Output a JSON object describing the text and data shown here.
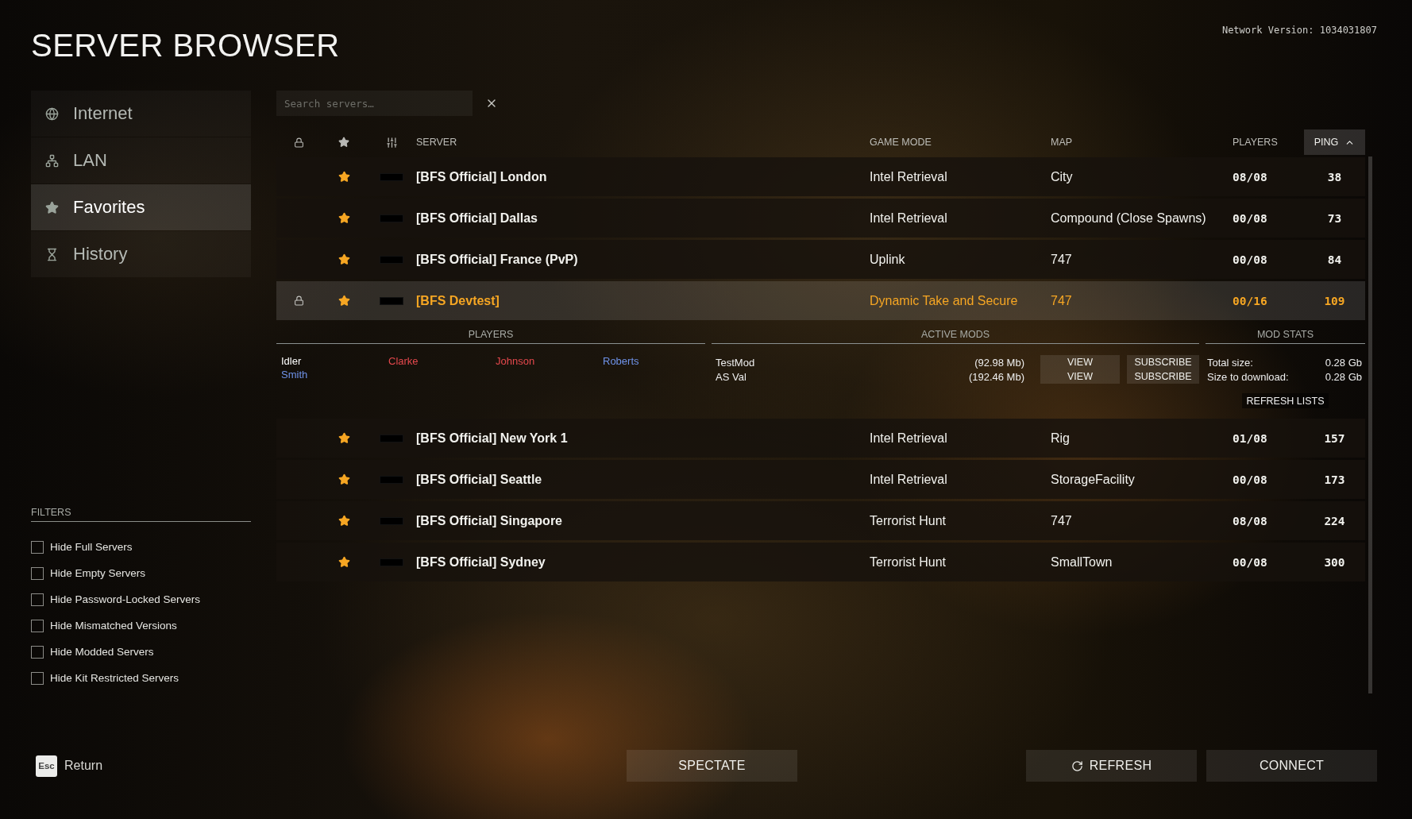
{
  "title": "SERVER BROWSER",
  "network_version": "Network Version: 1034031807",
  "nav": [
    {
      "label": "Internet",
      "kind": "globe",
      "selected": false
    },
    {
      "label": "LAN",
      "kind": "network",
      "selected": false
    },
    {
      "label": "Favorites",
      "kind": "star",
      "selected": true
    },
    {
      "label": "History",
      "kind": "hourglass",
      "selected": false
    }
  ],
  "search": {
    "placeholder": "Search servers…"
  },
  "columns": [
    {
      "label": "SERVER",
      "selected": false
    },
    {
      "label": "GAME MODE",
      "selected": false
    },
    {
      "label": "MAP",
      "selected": false
    },
    {
      "label": "PLAYERS",
      "selected": false
    },
    {
      "label": "PING",
      "selected": true
    }
  ],
  "servers": [
    {
      "name": "[BFS Official] London",
      "game_mode": "Intel Retrieval",
      "map": "City",
      "players": "08/08",
      "ping": "38",
      "locked": false,
      "favorite": true,
      "selected": false
    },
    {
      "name": "[BFS Official] Dallas",
      "game_mode": "Intel Retrieval",
      "map": "Compound (Close Spawns)",
      "players": "00/08",
      "ping": "73",
      "locked": false,
      "favorite": true,
      "selected": false
    },
    {
      "name": "[BFS Official] France (PvP)",
      "game_mode": "Uplink",
      "map": "747",
      "players": "00/08",
      "ping": "84",
      "locked": false,
      "favorite": true,
      "selected": false
    },
    {
      "name": "[BFS Devtest]",
      "game_mode": "Dynamic Take and Secure",
      "map": "747",
      "players": "00/16",
      "ping": "109",
      "locked": true,
      "favorite": true,
      "selected": true,
      "details": {
        "sections": [
          "PLAYERS",
          "ACTIVE MODS",
          "MOD STATS"
        ],
        "players": [
          {
            "name": "Idler",
            "color": "#ffffff"
          },
          {
            "name": "Clarke",
            "color": "#e5484d"
          },
          {
            "name": "Johnson",
            "color": "#e5484d"
          },
          {
            "name": "Roberts",
            "color": "#6f93ea"
          },
          {
            "name": "Smith",
            "color": "#6f93ea"
          }
        ],
        "mods": [
          {
            "name": "TestMod",
            "size": "(92.98 Mb)",
            "view": "VIEW",
            "subscribe": "SUBSCRIBE"
          },
          {
            "name": "AS Val",
            "size": "(192.46 Mb)",
            "view": "VIEW",
            "subscribe": "SUBSCRIBE"
          }
        ],
        "stats": [
          {
            "label": "Total size:",
            "value": "0.28 Gb"
          },
          {
            "label": "Size to download:",
            "value": "0.28 Gb"
          }
        ],
        "refresh": "REFRESH LISTS"
      }
    },
    {
      "name": "[BFS Official] New York 1",
      "game_mode": "Intel Retrieval",
      "map": "Rig",
      "players": "01/08",
      "ping": "157",
      "locked": false,
      "favorite": true,
      "selected": false
    },
    {
      "name": "[BFS Official] Seattle",
      "game_mode": "Intel Retrieval",
      "map": "StorageFacility",
      "players": "00/08",
      "ping": "173",
      "locked": false,
      "favorite": true,
      "selected": false
    },
    {
      "name": "[BFS Official] Singapore",
      "game_mode": "Terrorist Hunt",
      "map": "747",
      "players": "08/08",
      "ping": "224",
      "locked": false,
      "favorite": true,
      "selected": false
    },
    {
      "name": "[BFS Official] Sydney",
      "game_mode": "Terrorist Hunt",
      "map": "SmallTown",
      "players": "00/08",
      "ping": "300",
      "locked": false,
      "favorite": true,
      "selected": false
    }
  ],
  "filters": {
    "title": "FILTERS",
    "items": [
      {
        "label": "Hide Full Servers",
        "checked": false
      },
      {
        "label": "Hide Empty Servers",
        "checked": false
      },
      {
        "label": "Hide Password-Locked Servers",
        "checked": false
      },
      {
        "label": "Hide Mismatched Versions",
        "checked": false
      },
      {
        "label": "Hide Modded Servers",
        "checked": false
      },
      {
        "label": "Hide Kit Restricted Servers",
        "checked": false
      }
    ]
  },
  "footer": {
    "key": "Esc",
    "return": "Return",
    "buttons": [
      {
        "label": "SPECTATE",
        "kind": "plain"
      },
      {
        "label": "REFRESH",
        "kind": "refresh"
      },
      {
        "label": "CONNECT",
        "kind": "plain"
      }
    ]
  }
}
